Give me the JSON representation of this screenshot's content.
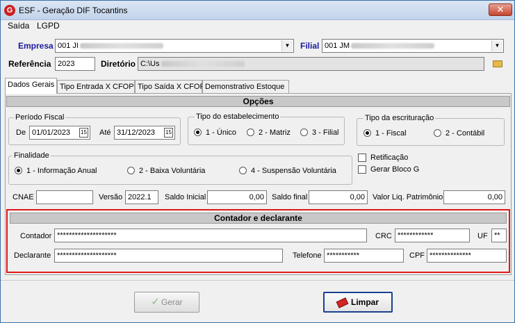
{
  "window": {
    "title": "ESF - Geração DIF Tocantins",
    "app_icon": "G",
    "close_glyph": "✕"
  },
  "menu": {
    "items": [
      {
        "label": "Saída"
      },
      {
        "label": "LGPD"
      }
    ]
  },
  "header": {
    "empresa_label": "Empresa",
    "empresa_value": "001 JI",
    "filial_label": "Filial",
    "filial_value": "001 JM",
    "referencia_label": "Referência",
    "referencia_value": "2023",
    "diretorio_label": "Diretório",
    "diretorio_value": "C:\\Us"
  },
  "tabs": [
    {
      "label": "Dados Gerais",
      "active": true
    },
    {
      "label": "Tipo Entrada X CFOP"
    },
    {
      "label": "Tipo Saída X CFOP"
    },
    {
      "label": "Demonstrativo Estoque"
    }
  ],
  "opcoes": {
    "title": "Opções",
    "periodo": {
      "title": "Período Fiscal",
      "de_label": "De",
      "de_value": "01/01/2023",
      "ate_label": "Até",
      "ate_value": "31/12/2023",
      "calendar_glyph": "15"
    },
    "estabelecimento": {
      "title": "Tipo do estabelecimento",
      "options": [
        "1 - Único",
        "2 - Matriz",
        "3 - Filial"
      ],
      "selected": "1 - Único"
    },
    "escrituracao": {
      "title": "Tipo da escrituração",
      "options": [
        "1 - Fiscal",
        "2 - Contábil"
      ],
      "selected": "1 - Fiscal"
    },
    "finalidade": {
      "title": "Finalidade",
      "options": [
        "1 - Informação Anual",
        "2 - Baixa Voluntária",
        "4 - Suspensão Voluntária"
      ],
      "selected": "1 - Informação Anual"
    },
    "retificacao_label": "Retificação",
    "gerar_bloco_g_label": "Gerar Bloco G",
    "cnae_label": "CNAE",
    "cnae_value": "",
    "versao_label": "Versão",
    "versao_value": "2022.1",
    "saldo_inicial_label": "Saldo Inicial",
    "saldo_inicial_value": "0,00",
    "saldo_final_label": "Saldo final",
    "saldo_final_value": "0,00",
    "patrimonio_label": "Valor Liq. Patrimônio",
    "patrimonio_value": "0,00"
  },
  "contador": {
    "title": "Contador e declarante",
    "contador_label": "Contador",
    "contador_value": "********************",
    "crc_label": "CRC",
    "crc_value": "************",
    "uf_label": "UF",
    "uf_value": "**",
    "declarante_label": "Declarante",
    "declarante_value": "********************",
    "telefone_label": "Telefone",
    "telefone_value": "***********",
    "cpf_label": "CPF",
    "cpf_value": "**************"
  },
  "buttons": {
    "gerar_label": "Gerar",
    "limpar_label": "Limpar"
  },
  "icons": {
    "check": "✓",
    "dropdown": "▼"
  }
}
